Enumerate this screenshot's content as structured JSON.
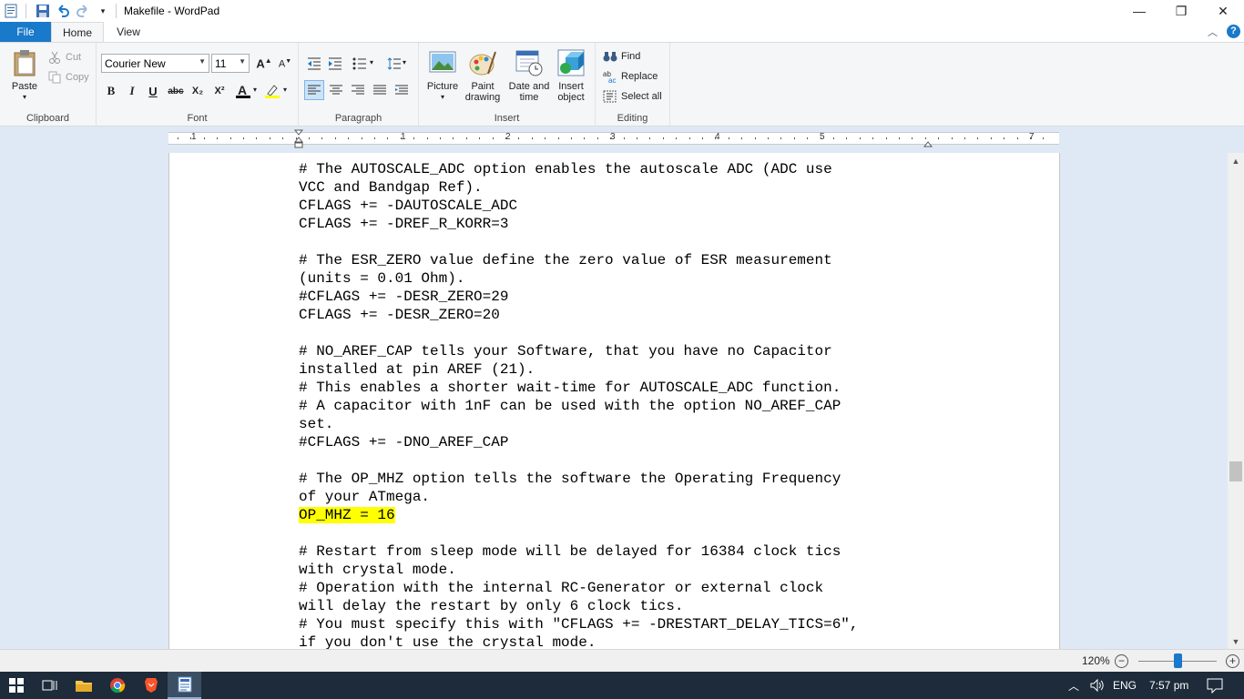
{
  "window": {
    "title": "Makefile - WordPad",
    "minimize_glyph": "—",
    "maximize_glyph": "❐",
    "close_glyph": "✕"
  },
  "tabs": [
    {
      "label": "File"
    },
    {
      "label": "Home"
    },
    {
      "label": "View"
    }
  ],
  "ribbon": {
    "clipboard": {
      "group_label": "Clipboard",
      "paste_label": "Paste",
      "cut_label": "Cut",
      "copy_label": "Copy"
    },
    "font": {
      "group_label": "Font",
      "font_name": "Courier New",
      "font_size": "11",
      "bold": "B",
      "italic": "I",
      "underline": "U",
      "strikethrough": "abc",
      "subscript": "X₂",
      "superscript": "X²"
    },
    "paragraph": {
      "group_label": "Paragraph"
    },
    "insert": {
      "group_label": "Insert",
      "picture_label": "Picture",
      "paint_label": "Paint drawing",
      "datetime_label": "Date and time",
      "object_label": "Insert object"
    },
    "editing": {
      "group_label": "Editing",
      "find_label": "Find",
      "replace_label": "Replace",
      "selectall_label": "Select all"
    },
    "accent_color": "#1979ca",
    "highlight_color": "#ffff00",
    "font_color": "#000000"
  },
  "ruler": {
    "numbers": [
      "1",
      "1",
      "2",
      "3",
      "4",
      "5",
      "7"
    ]
  },
  "document": {
    "lines": [
      "# The AUTOSCALE_ADC option enables the autoscale ADC (ADC use",
      "VCC and Bandgap Ref).",
      "CFLAGS += -DAUTOSCALE_ADC",
      "CFLAGS += -DREF_R_KORR=3",
      "",
      "# The ESR_ZERO value define the zero value of ESR measurement",
      "(units = 0.01 Ohm).",
      "#CFLAGS += -DESR_ZERO=29",
      "CFLAGS += -DESR_ZERO=20",
      "",
      "# NO_AREF_CAP tells your Software, that you have no Capacitor",
      "installed at pin AREF (21).",
      "# This enables a shorter wait-time for AUTOSCALE_ADC function.",
      "# A capacitor with 1nF can be used with the option NO_AREF_CAP",
      "set.",
      "#CFLAGS += -DNO_AREF_CAP",
      "",
      "# The OP_MHZ option tells the software the Operating Frequency",
      "of your ATmega.",
      "OP_MHZ = 16",
      "",
      "# Restart from sleep mode will be delayed for 16384 clock tics",
      "with crystal mode.",
      "# Operation with the internal RC-Generator or external clock",
      "will delay the restart by only 6 clock tics.",
      "# You must specify this with \"CFLAGS += -DRESTART_DELAY_TICS=6\",",
      "if you don't use the crystal mode."
    ],
    "highlighted_line_index": 19
  },
  "statusbar": {
    "zoom_label": "120%",
    "zoom_out": "−",
    "zoom_in": "+",
    "zoom_fraction": 0.5
  },
  "taskbar": {
    "language": "ENG",
    "time": "7:57 pm"
  }
}
